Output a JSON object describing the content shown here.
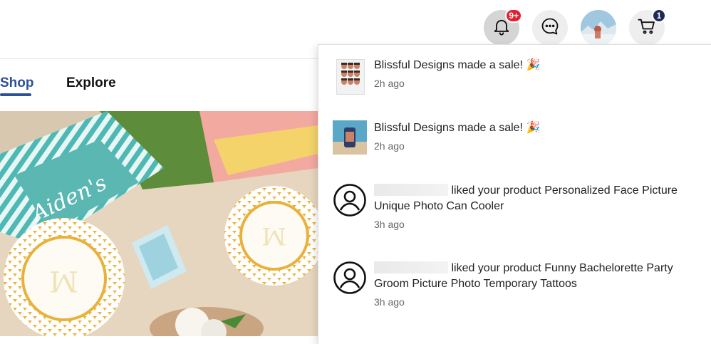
{
  "header": {
    "notifications_badge": "9+",
    "cart_badge": "1",
    "colors": {
      "notif_badge": "#e2202e",
      "cart_badge": "#1d2b56"
    },
    "icons": [
      "bell-icon",
      "chat-icon",
      "avatar",
      "cart-icon"
    ]
  },
  "nav": {
    "tabs": [
      {
        "label": "Shop"
      },
      {
        "label": "Explore"
      }
    ],
    "active_tab": "Shop"
  },
  "notifications": [
    {
      "message": "Blissful Designs made a sale!",
      "emoji": "🎉",
      "time": "2h ago",
      "thumb": "face-tattoo-sheet"
    },
    {
      "message": "Blissful Designs made a sale!",
      "emoji": "🎉",
      "time": "2h ago",
      "thumb": "can-cooler-photo"
    },
    {
      "message": "liked your product Personalized Face Picture Unique Photo Can Cooler",
      "time": "3h ago",
      "thumb": "user-icon"
    },
    {
      "message": "liked your product Funny Bachelorette Party Groom Picture Photo Temporary Tattoos",
      "time": "3h ago",
      "thumb": "user-icon"
    }
  ]
}
